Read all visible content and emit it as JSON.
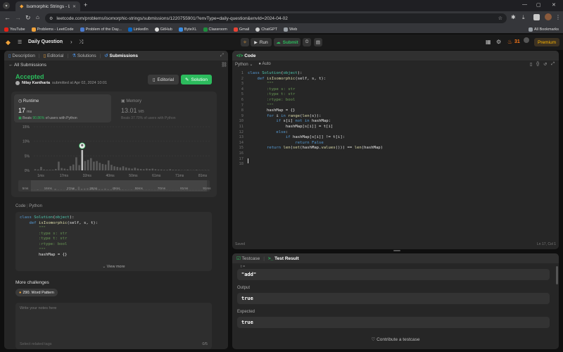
{
  "browser": {
    "tab_title": "Isomorphic Strings - LeetCode",
    "url": "leetcode.com/problems/isomorphic-strings/submissions/1220755901/?envType=daily-question&envId=2024-04-02",
    "bookmarks": [
      "YouTube",
      "Problems - LeetCode",
      "Problem of the Day...",
      "LinkedIn",
      "GitHub",
      "ByteXL",
      "Classroom",
      "Gmail",
      "ChatGPT",
      "Web"
    ],
    "all_bookmarks": "All Bookmarks"
  },
  "nav": {
    "daily": "Daily Question",
    "run": "Run",
    "submit": "Submit",
    "streak": "31",
    "premium": "Premium"
  },
  "left": {
    "tabs": [
      "Description",
      "Editorial",
      "Solutions",
      "Submissions"
    ],
    "all_submissions": "All Submissions",
    "status": "Accepted",
    "user": "Nilay Kantharia",
    "submitted": "submitted at Apr 02, 2024 10:01",
    "editorial_btn": "Editorial",
    "solution_btn": "Solution",
    "runtime_label": "Runtime",
    "runtime_value": "17",
    "runtime_unit": "ms",
    "runtime_beats": "Beats",
    "runtime_pct": "90.86%",
    "runtime_suffix": "of users with Python",
    "memory_label": "Memory",
    "memory_value": "13.01",
    "memory_unit": "MB",
    "memory_beats": "Beats 37.70% of users with Python",
    "code_label": "Code",
    "code_lang": "Python",
    "view_more": "View more",
    "more_challenges": "More challenges",
    "challenge": "290. Word Pattern",
    "notes_placeholder": "Write your notes here",
    "tags_placeholder": "Select related tags",
    "notes_count": "0/5"
  },
  "chart_data": {
    "type": "bar",
    "yticks": [
      "15%",
      "10%",
      "5%",
      "0%"
    ],
    "xticks": [
      "1ms",
      "17ms",
      "32ms",
      "40ms",
      "50ms",
      "61ms",
      "71ms",
      "81ms"
    ],
    "brush_ticks": [
      "5ms",
      "16ms",
      "27ms",
      "38ms",
      "49ms",
      "59ms",
      "70ms",
      "81ms",
      "91ms"
    ],
    "ylim": [
      0,
      15
    ],
    "values": [
      0.4,
      0.3,
      1.2,
      0.3,
      0.2,
      0.2,
      0.2,
      0.5,
      3.0,
      0.8,
      0.6,
      0.4,
      1.5,
      2.0,
      4.5,
      1.8,
      7.0,
      3.2,
      3.6,
      4.2,
      3.0,
      3.2,
      2.6,
      2.2,
      2.0,
      3.4,
      1.9,
      1.4,
      1.2,
      1.0,
      1.4,
      1.0,
      0.8,
      0.6,
      0.9,
      0.6,
      0.5,
      0.4,
      0.6,
      0.5,
      0.6,
      0.4,
      0.3,
      0.3,
      0.2,
      0.2,
      0.4,
      0.2,
      0.2,
      0.2,
      0.1,
      0.1,
      0.2,
      0.1,
      0.1,
      0.2,
      0.1,
      0.1,
      0.1,
      0.1
    ],
    "highlight_index": 16
  },
  "code": {
    "title": "Code",
    "lang": "Python",
    "mode": "Auto",
    "saved": "Saved",
    "cursor": "Ln 17, Col 1",
    "lines": [
      "class Solution(object):",
      "    def isIsomorphic(self, s, t):",
      "        \"\"\"",
      "        :type s: str",
      "        :type t: str",
      "        :rtype: bool",
      "        \"\"\"",
      "        hashMap = {}",
      "        for i in range(len(s)):",
      "            if s[i] not in hashMap:",
      "                hashMap[s[i]] = t[i]",
      "            else:",
      "                if hashMap[s[i]] != t[i]:",
      "                    return False",
      "        return len(set(hashMap.values())) == len(hashMap)",
      "",
      "",
      ""
    ],
    "preview_lines": [
      "class Solution(object):",
      "    def isIsomorphic(self, s, t):",
      "        \"\"\"",
      "        :type s: str",
      "        :type t: str",
      "        :rtype: bool",
      "        \"\"\"",
      "        hashMap = {}"
    ]
  },
  "testpanel": {
    "tab1": "Testcase",
    "tab2": "Test Result",
    "var": "t =",
    "input_value": "\"add\"",
    "output_label": "Output",
    "output_value": "true",
    "expected_label": "Expected",
    "expected_value": "true",
    "contribute": "Contribute a testcase"
  }
}
